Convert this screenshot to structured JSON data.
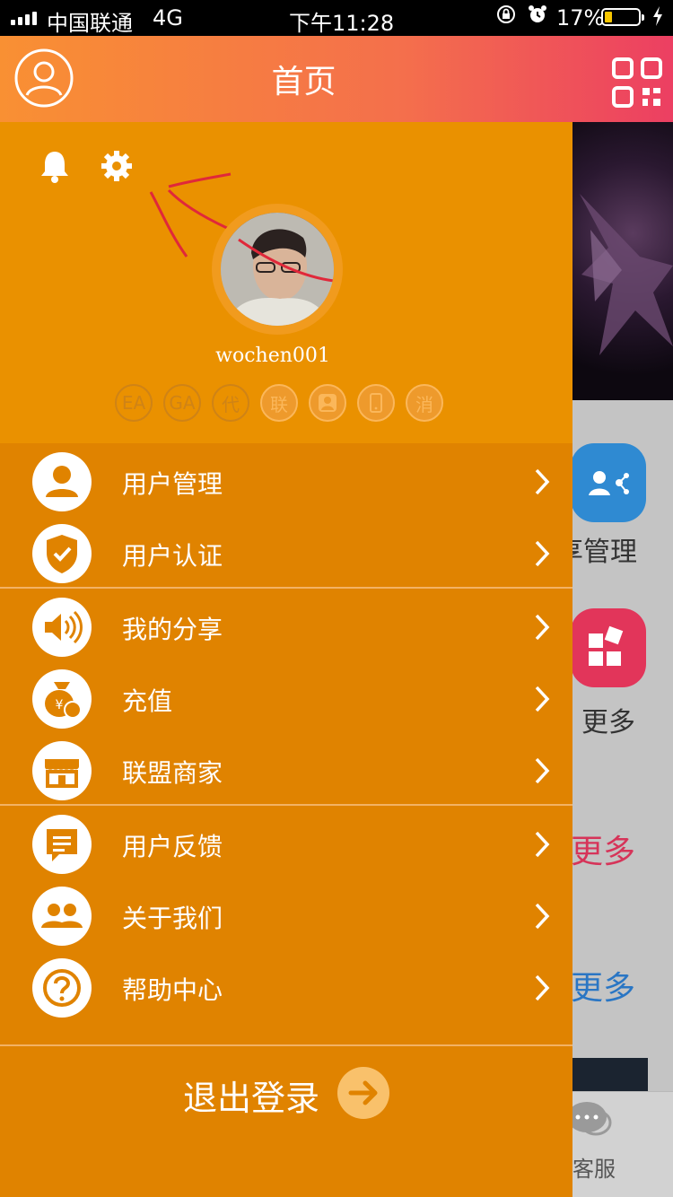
{
  "status_bar": {
    "carrier": "中国联通",
    "network": "4G",
    "time": "下午11:28",
    "battery_percent": "17%",
    "battery_level": 0.17
  },
  "header": {
    "title": "首页",
    "avatar_icon": "user-circle-icon",
    "scan_icon": "qr-code-icon"
  },
  "background": {
    "share_label": "享管理",
    "more_label": "更多",
    "more_link_1": "更多",
    "more_link_2": "更多",
    "service_label": "客服"
  },
  "drawer": {
    "username": "wochen001",
    "badges": [
      "EA",
      "GA",
      "代",
      "联",
      "👤",
      "📱",
      "消"
    ],
    "menu": [
      {
        "label": "用户管理",
        "icon": "user-icon"
      },
      {
        "label": "用户认证",
        "icon": "shield-check-icon"
      },
      {
        "label": "我的分享",
        "icon": "speaker-icon"
      },
      {
        "label": "充值",
        "icon": "money-bag-icon"
      },
      {
        "label": "联盟商家",
        "icon": "store-icon"
      },
      {
        "label": "用户反馈",
        "icon": "feedback-icon"
      },
      {
        "label": "关于我们",
        "icon": "group-icon"
      },
      {
        "label": "帮助中心",
        "icon": "help-icon"
      }
    ],
    "logout_label": "退出登录"
  },
  "colors": {
    "drawer": "#e08300",
    "drawer_top": "#ea9100",
    "header_start": "#f99033",
    "header_end": "#ec3f62"
  }
}
